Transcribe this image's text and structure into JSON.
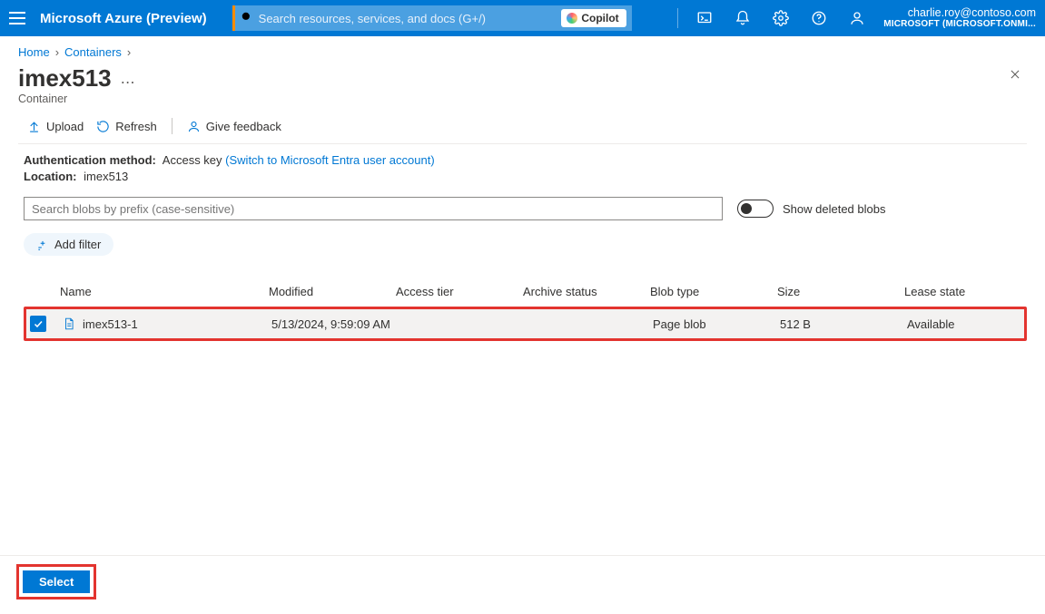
{
  "header": {
    "brand": "Microsoft Azure (Preview)",
    "search_placeholder": "Search resources, services, and docs (G+/)",
    "copilot_label": "Copilot",
    "account_email": "charlie.roy@contoso.com",
    "account_tenant": "MICROSOFT (MICROSOFT.ONMI..."
  },
  "breadcrumb": {
    "items": [
      "Home",
      "Containers"
    ]
  },
  "page": {
    "title": "imex513",
    "subtitle": "Container"
  },
  "toolbar": {
    "upload": "Upload",
    "refresh": "Refresh",
    "feedback": "Give feedback"
  },
  "meta": {
    "auth_label": "Authentication method:",
    "auth_value": "Access key",
    "auth_link": "(Switch to Microsoft Entra user account)",
    "loc_label": "Location:",
    "loc_value": "imex513"
  },
  "search": {
    "prefix_placeholder": "Search blobs by prefix (case-sensitive)",
    "toggle_label": "Show deleted blobs"
  },
  "filter": {
    "add_label": "Add filter"
  },
  "table": {
    "columns": [
      "Name",
      "Modified",
      "Access tier",
      "Archive status",
      "Blob type",
      "Size",
      "Lease state"
    ],
    "rows": [
      {
        "name": "imex513-1",
        "modified": "5/13/2024, 9:59:09 AM",
        "access_tier": "",
        "archive_status": "",
        "blob_type": "Page blob",
        "size": "512 B",
        "lease_state": "Available"
      }
    ]
  },
  "footer": {
    "select": "Select"
  }
}
